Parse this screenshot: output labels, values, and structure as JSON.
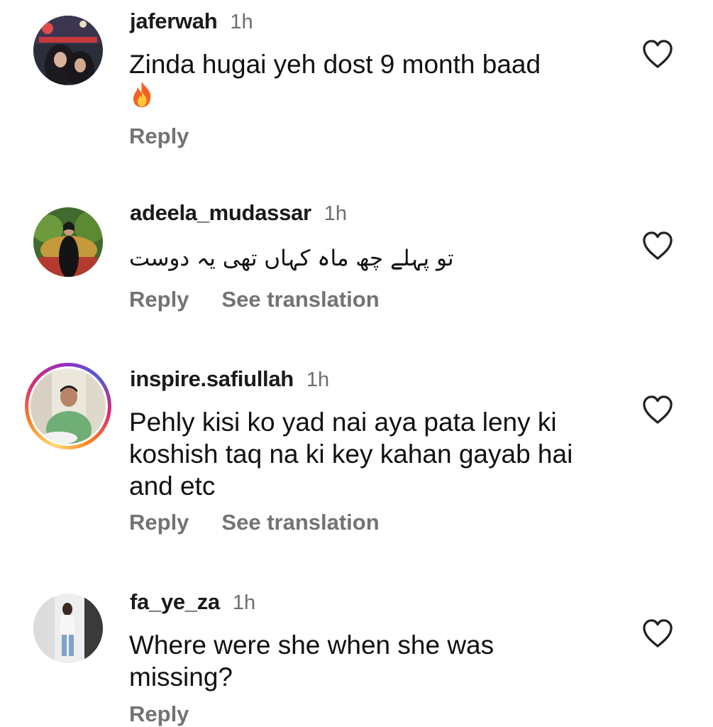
{
  "comments": [
    {
      "username": "jaferwah",
      "time": "1h",
      "text": "Zinda hugai yeh dost 9 month baad",
      "emoji": "fire",
      "actions": [
        "Reply"
      ],
      "avatar_ring": false
    },
    {
      "username": "adeela_mudassar",
      "time": "1h",
      "text": "تو پہلے چھ ماہ کہاں تھی یہ دوست",
      "actions": [
        "Reply",
        "See translation"
      ],
      "avatar_ring": false
    },
    {
      "username": "inspire.safiullah",
      "time": "1h",
      "text": "Pehly kisi ko yad nai aya pata leny ki koshish taq na ki key kahan gayab hai and etc",
      "actions": [
        "Reply",
        "See translation"
      ],
      "avatar_ring": true
    },
    {
      "username": "fa_ye_za",
      "time": "1h",
      "text": "Where were she when she was missing?",
      "actions": [
        "Reply"
      ],
      "avatar_ring": false
    }
  ],
  "icons": {
    "like": "heart-outline-icon",
    "emoji": "fire-emoji-icon"
  },
  "colors": {
    "username": "#1a1a1a",
    "secondary": "#737373",
    "story_ring": [
      "#feda75",
      "#fa7e1e",
      "#d62976",
      "#962fbf"
    ]
  }
}
